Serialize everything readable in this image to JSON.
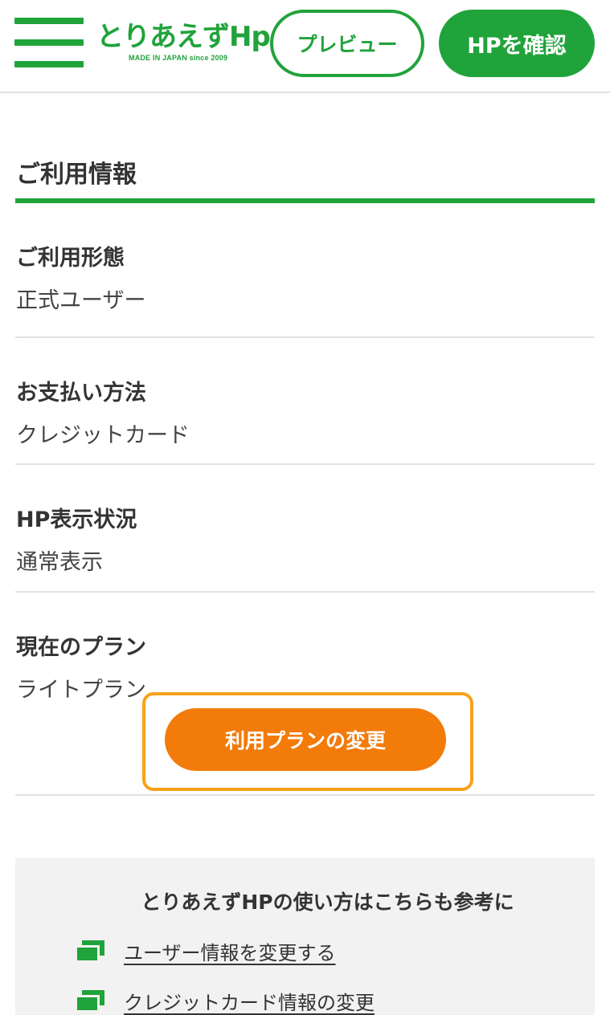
{
  "header": {
    "logo_text": "とりあえずHp",
    "logo_tagline": "MADE IN JAPAN since 2009",
    "preview_label": "プレビュー",
    "hp_confirm_label": "HPを確認"
  },
  "section": {
    "title": "ご利用情報"
  },
  "info": {
    "usage_type": {
      "label": "ご利用形態",
      "value": "正式ユーザー"
    },
    "payment": {
      "label": "お支払い方法",
      "value": "クレジットカード"
    },
    "hp_status": {
      "label": "HP表示状況",
      "value": "通常表示"
    },
    "plan": {
      "label": "現在のプラン",
      "value": "ライトプラン",
      "change_label": "利用プランの変更"
    }
  },
  "help": {
    "title": "とりあえずHPの使い方はこちらも参考に",
    "links": [
      {
        "label": "ユーザー情報を変更する"
      },
      {
        "label": "クレジットカード情報の変更"
      }
    ]
  },
  "colors": {
    "brand_green": "#20a33b",
    "accent_orange": "#f27b0a",
    "highlight_outline": "#f7a21b"
  },
  "icons": {
    "menu": "hamburger-menu-icon",
    "link": "external-window-icon"
  }
}
